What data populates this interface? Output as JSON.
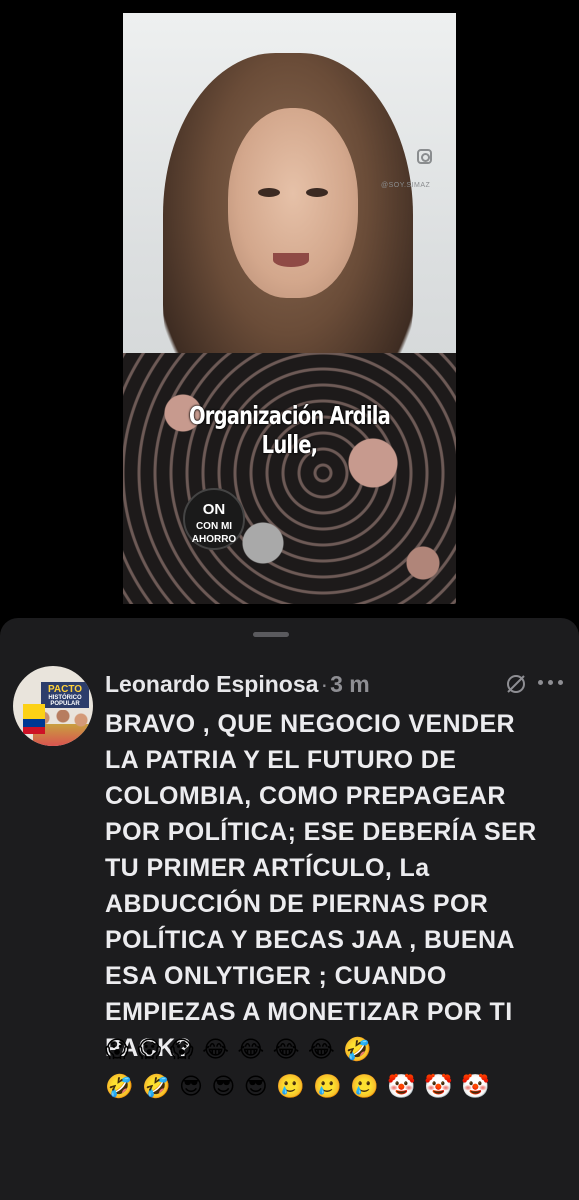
{
  "video": {
    "caption": "Organización Ardila Lulle,",
    "watermark_handle": "@SOY.SIMAZ",
    "badge_line1": "ON",
    "badge_line2": "CON MI",
    "badge_line3": "AHORRO",
    "icon": "instagram-icon"
  },
  "comment": {
    "author": "Leonardo Espinosa",
    "separator": "·",
    "time": "3 m",
    "text": "BRAVO , QUE NEGOCIO VENDER LA PATRIA Y EL FUTURO DE COLOMBIA, COMO PREPAGEAR POR POLÍTICA; ESE DEBERÍA SER TU PRIMER ARTÍCULO, La ABDUCCIÓN DE PIERNAS POR POLÍTICA Y BECAS JAA , BUENA ESA ONLYTIGER ; CUANDO EMPIEZAS A MONETIZAR POR TI PACK?",
    "emojis_line1": "😱 😱 😱 😂 😂 😂 😂 🤣",
    "emojis_line2": "🤣 🤣 😎 😎 😎 🥲 🥲 🥲 🤡 🤡 🤡",
    "avatar_sign": "PACTO",
    "avatar_sign_sub": "HISTÓRICO",
    "avatar_sign_sub2": "POPULAR",
    "icons": [
      "avatar",
      "translate-off-icon",
      "more-icon"
    ]
  },
  "colors": {
    "sheet_background": "#1c1c1e",
    "text_primary": "#e7e7ea",
    "text_secondary": "#8e8e93"
  }
}
